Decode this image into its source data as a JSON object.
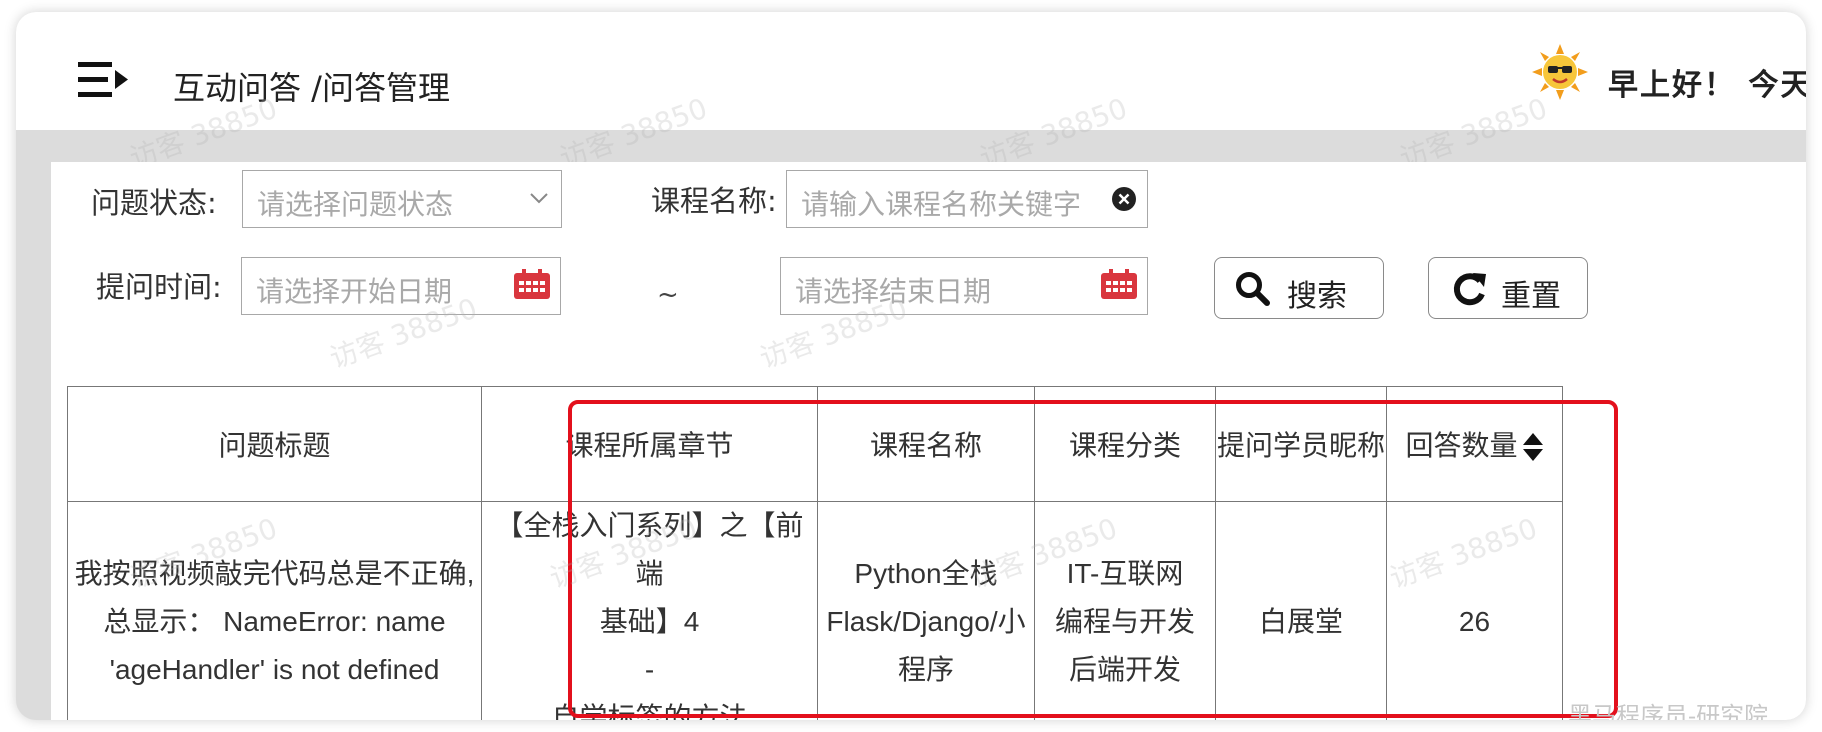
{
  "header": {
    "breadcrumb": "互动问答 /问答管理",
    "greeting": "早上好！ 今天"
  },
  "filters": {
    "status_label": "问题状态:",
    "status_placeholder": "请选择问题状态",
    "course_label": "课程名称:",
    "course_placeholder": "请输入课程名称关键字",
    "time_label": "提问时间:",
    "start_placeholder": "请选择开始日期",
    "range_separator": "~",
    "end_placeholder": "请选择结束日期",
    "search_label": "搜索",
    "reset_label": "重置"
  },
  "table": {
    "columns": [
      "问题标题",
      "课程所属章节",
      "课程名称",
      "课程分类",
      "提问学员昵称",
      "回答数量"
    ],
    "rows": [
      {
        "title_lines": [
          "我按照视频敲完代码总是不正确,",
          "总显示： NameError: name",
          "'ageHandler' is not defined"
        ],
        "chapter_lines": [
          "【全栈入门系列】之【前端",
          "基础】4",
          "-",
          "自学标签的方法"
        ],
        "course_lines": [
          "Python全栈",
          "Flask/Django/小",
          "程序"
        ],
        "category_lines": [
          "IT-互联网",
          "编程与开发",
          "后端开发"
        ],
        "nickname": "白展堂",
        "answers": "26"
      }
    ]
  },
  "watermark": "访客 38850",
  "brand_watermark": "黑马程序员-研究院",
  "colors": {
    "highlight": "#e3101c",
    "calendar": "#d9363e"
  }
}
